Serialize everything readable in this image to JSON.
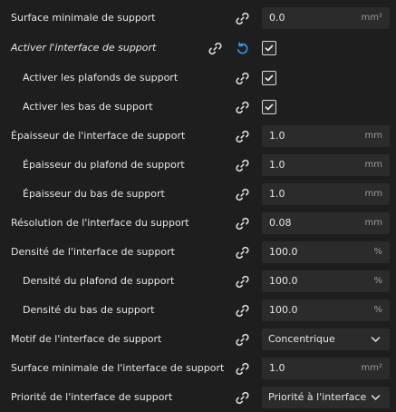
{
  "rows": [
    {
      "label": "Surface minimale de support",
      "value": "0.0",
      "unit": "mm²"
    },
    {
      "label": "Activer l'interface de support"
    },
    {
      "label": "Activer les plafonds de support"
    },
    {
      "label": "Activer les bas de support"
    },
    {
      "label": "Épaisseur de l'interface de support",
      "value": "1.0",
      "unit": "mm"
    },
    {
      "label": "Épaisseur du plafond de support",
      "value": "1.0",
      "unit": "mm"
    },
    {
      "label": "Épaisseur du bas de support",
      "value": "1.0",
      "unit": "mm"
    },
    {
      "label": "Résolution de l'interface du support",
      "value": "0.08",
      "unit": "mm"
    },
    {
      "label": "Densité de l'interface de support",
      "value": "100.0",
      "unit": "%"
    },
    {
      "label": "Densité du plafond de support",
      "value": "100.0",
      "unit": "%"
    },
    {
      "label": "Densité du bas de support",
      "value": "100.0",
      "unit": "%"
    },
    {
      "label": "Motif de l'interface de support",
      "value": "Concentrique"
    },
    {
      "label": "Surface minimale de l'interface de support",
      "value": "1.0",
      "unit": "mm²"
    },
    {
      "label": "Priorité de l'interface de support",
      "value": "Priorité à l'interface"
    }
  ],
  "icons": {
    "link": "link-icon",
    "reset": "reset-icon",
    "check": "check-icon",
    "chevron": "chevron-down-icon"
  },
  "colors": {
    "background": "#1e1e1e",
    "field": "#2b2b2b",
    "reset_blue": "#3a8ee6"
  }
}
